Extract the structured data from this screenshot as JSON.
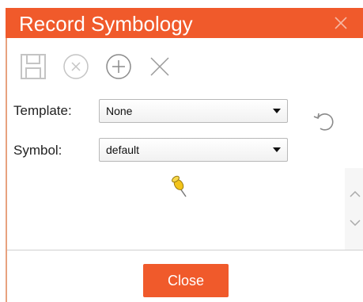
{
  "dialog": {
    "title": "Record Symbology",
    "close_icon": "x-icon",
    "accent_color": "#f05a2b"
  },
  "toolbar": {
    "icons": [
      "save-icon",
      "cancel-circle-icon",
      "add-circle-icon",
      "delete-x-icon"
    ]
  },
  "form": {
    "template_label": "Template:",
    "template_value": "None",
    "symbol_label": "Symbol:",
    "symbol_value": "default",
    "reset_icon": "undo-icon"
  },
  "preview": {
    "symbol_icon": "pushpin-icon"
  },
  "footer": {
    "close_label": "Close"
  }
}
